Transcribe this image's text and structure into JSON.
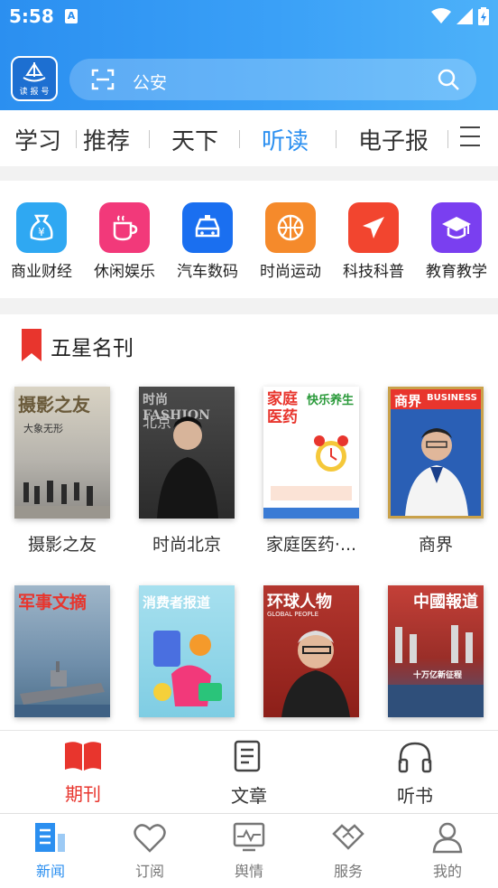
{
  "status": {
    "time": "5:58",
    "notif_letter": "A"
  },
  "logo": {
    "caption": "读 报 号"
  },
  "search": {
    "placeholder": "公安"
  },
  "tabs": [
    "学习",
    "推荐",
    "天下",
    "听读",
    "电子报"
  ],
  "active_tab": "听读",
  "categories": [
    {
      "label": "商业财经",
      "color": "#2fa8f2",
      "icon": "money-bag-icon"
    },
    {
      "label": "休闲娱乐",
      "color": "#f2397a",
      "icon": "coffee-cup-icon"
    },
    {
      "label": "汽车数码",
      "color": "#1a6ff0",
      "icon": "car-icon"
    },
    {
      "label": "时尚运动",
      "color": "#f58a2b",
      "icon": "basketball-icon"
    },
    {
      "label": "科技科普",
      "color": "#f2452f",
      "icon": "airplane-icon"
    },
    {
      "label": "教育教学",
      "color": "#7a3ff0",
      "icon": "graduation-cap-icon"
    }
  ],
  "section": {
    "title": "五星名刊"
  },
  "magazines": [
    {
      "name": "摄影之友",
      "cover_title": "摄影之友",
      "cover_sub": "大象无形",
      "bg": "#c9c4b8",
      "fg": "#6a5a3a"
    },
    {
      "name": "时尚北京",
      "cover_title": "时尚FASHION",
      "cover_sub": "北京",
      "bg": "#3a3a3a",
      "fg": "#d8d8d8"
    },
    {
      "name": "家庭医药·...",
      "cover_title": "家庭医药",
      "cover_sub": "快乐养生",
      "bg": "#ffffff",
      "fg": "#e8352d"
    },
    {
      "name": "商界",
      "cover_title": "商界",
      "cover_sub": "BUSINESS",
      "bg": "#2a5fb5",
      "fg": "#ffffff"
    },
    {
      "name": "",
      "cover_title": "军事文摘",
      "cover_sub": "",
      "bg": "#6f8eaa",
      "fg": "#e8352d"
    },
    {
      "name": "",
      "cover_title": "消费者报道",
      "cover_sub": "",
      "bg": "#8ad1e6",
      "fg": "#ffffff"
    },
    {
      "name": "",
      "cover_title": "环球人物",
      "cover_sub": "GLOBAL PEOPLE",
      "bg": "#a8261f",
      "fg": "#ffffff"
    },
    {
      "name": "",
      "cover_title": "中國報道",
      "cover_sub": "十万亿新征程",
      "bg": "#b3362e",
      "fg": "#ffffff"
    }
  ],
  "subtabs": [
    {
      "label": "期刊",
      "active": true
    },
    {
      "label": "文章",
      "active": false
    },
    {
      "label": "听书",
      "active": false
    }
  ],
  "bottom_nav": [
    {
      "label": "新闻",
      "active": true
    },
    {
      "label": "订阅",
      "active": false
    },
    {
      "label": "舆情",
      "active": false
    },
    {
      "label": "服务",
      "active": false
    },
    {
      "label": "我的",
      "active": false
    }
  ],
  "colors": {
    "accent": "#2b8ff0",
    "red": "#e8352d"
  }
}
